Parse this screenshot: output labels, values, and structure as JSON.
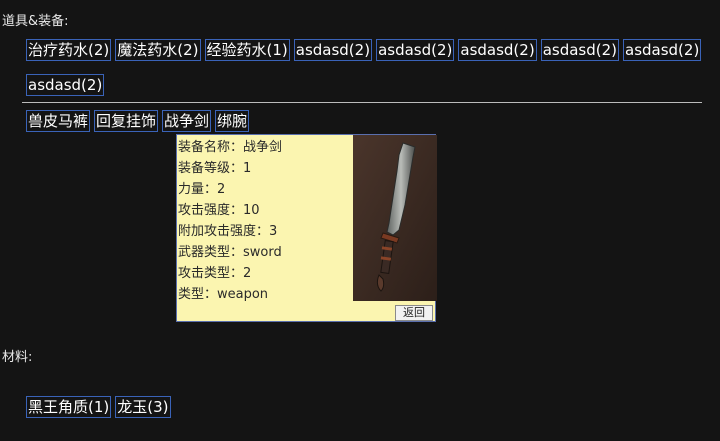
{
  "items_section": {
    "label": "道具&装备:",
    "consumables_row1": [
      "治疗药水(2)",
      "魔法药水(2)",
      "经验药水(1)",
      "asdasd(2)",
      "asdasd(2)",
      "asdasd(2)",
      "asdasd(2)",
      "asdasd(2)"
    ],
    "consumables_row2": [
      "asdasd(2)"
    ],
    "equipment": [
      "兽皮马裤",
      "回复挂饰",
      "战争剑",
      "绑腕"
    ]
  },
  "tooltip": {
    "lines": [
      "装备名称：战争剑",
      "装备等级：1",
      "力量：2",
      "攻击强度：10",
      "附加攻击强度：3",
      "武器类型：sword",
      "攻击类型：2",
      "类型：weapon"
    ],
    "image_icon": "sword-icon",
    "back_label": "返回",
    "background_color": "#fbf5b0"
  },
  "materials_section": {
    "label": "材料:",
    "items": [
      "黑王角质(1)",
      "龙玉(3)"
    ]
  },
  "colors": {
    "background": "#141414",
    "item_border": "#3a63b8"
  }
}
